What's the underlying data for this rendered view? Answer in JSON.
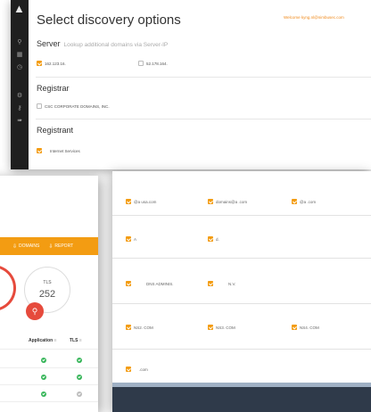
{
  "discovery": {
    "title": "Select discovery options",
    "welcome": "Welcome kyng.nl@nimbusec.com",
    "server": {
      "heading": "Server",
      "subtitle": "Lookup additional domains via Server-IP",
      "options": [
        {
          "label": "162.123.16.",
          "checked": true
        },
        {
          "label": "52.178.164.",
          "checked": false
        }
      ]
    },
    "registrar": {
      "heading": "Registrar",
      "options": [
        {
          "label": "CSC CORPORATE DOMAINS, INC.",
          "checked": false
        }
      ]
    },
    "registrant": {
      "heading": "Registrant",
      "options": [
        {
          "label": "Internet Services",
          "checked": true
        }
      ]
    }
  },
  "summary": {
    "actions": {
      "domains": "DOMAINS",
      "report": "REPORT"
    },
    "tls": {
      "label": "TLS",
      "value": "252"
    },
    "table": {
      "headers": [
        "Application",
        "TLS"
      ]
    }
  },
  "domains_grid": {
    "rows": [
      [
        {
          "label": "@a       usa.com",
          "checked": true
        },
        {
          "label": "domains@a       .com",
          "checked": true
        },
        {
          "label": "@a       .com",
          "checked": true
        }
      ],
      [
        {
          "label": "A",
          "checked": true
        },
        {
          "label": "d.",
          "checked": true
        }
      ],
      [
        {
          "label": "DNS ADMINIS.",
          "checked": true
        },
        {
          "label": "N.V.",
          "checked": true
        }
      ],
      [
        {
          "label": "NS2.            COM",
          "checked": true
        },
        {
          "label": "NS3.            COM",
          "checked": true
        },
        {
          "label": "NS4.            COM",
          "checked": true
        }
      ],
      [
        {
          "label": ".com",
          "checked": true
        }
      ]
    ]
  },
  "colors": {
    "accent": "#f39c12",
    "danger": "#e64a3c",
    "success": "#35b558",
    "sidebar": "#1f1f1f"
  }
}
